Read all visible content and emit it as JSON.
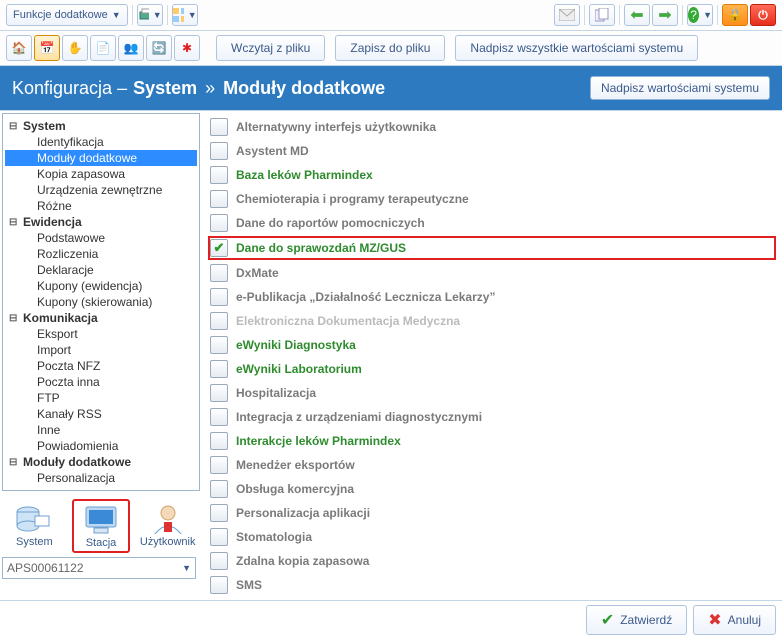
{
  "top_toolbar": {
    "functions_label": "Funkcje dodatkowe"
  },
  "second_toolbar": {
    "buttons": {
      "load": "Wczytaj z pliku",
      "save": "Zapisz do pliku",
      "overwrite_all": "Nadpisz wszystkie wartościami systemu"
    }
  },
  "breadcrumb": {
    "prefix": "Konfiguracja –",
    "section": "System",
    "sep": "»",
    "sub": "Moduły dodatkowe",
    "right_btn": "Nadpisz wartościami systemu"
  },
  "tree": {
    "categories": [
      {
        "label": "System",
        "children": [
          "Identyfikacja",
          "Moduły dodatkowe",
          "Kopia zapasowa",
          "Urządzenia zewnętrzne",
          "Różne"
        ],
        "selected": 1
      },
      {
        "label": "Ewidencja",
        "children": [
          "Podstawowe",
          "Rozliczenia",
          "Deklaracje",
          "Kupony (ewidencja)",
          "Kupony (skierowania)"
        ]
      },
      {
        "label": "Komunikacja",
        "children": [
          "Eksport",
          "Import",
          "Poczta NFZ",
          "Poczta inna",
          "FTP",
          "Kanały RSS",
          "Inne",
          "Powiadomienia"
        ]
      },
      {
        "label": "Moduły dodatkowe",
        "children": [
          "Personalizacja"
        ]
      }
    ]
  },
  "side_tabs": {
    "system": "System",
    "station": "Stacja",
    "user": "Użytkownik"
  },
  "status": {
    "code": "APS00061122"
  },
  "options": [
    {
      "label": "Alternatywny interfejs użytkownika",
      "checked": false,
      "style": "normal"
    },
    {
      "label": "Asystent MD",
      "checked": false,
      "style": "normal"
    },
    {
      "label": "Baza leków Pharmindex",
      "checked": false,
      "style": "green"
    },
    {
      "label": "Chemioterapia i programy terapeutyczne",
      "checked": false,
      "style": "normal"
    },
    {
      "label": "Dane do raportów pomocniczych",
      "checked": false,
      "style": "normal"
    },
    {
      "label": "Dane do sprawozdań MZ/GUS",
      "checked": true,
      "style": "green",
      "highlight": true
    },
    {
      "label": "DxMate",
      "checked": false,
      "style": "normal"
    },
    {
      "label": "e-Publikacja „Działalność Lecznicza Lekarzy”",
      "checked": false,
      "style": "normal"
    },
    {
      "label": "Elektroniczna Dokumentacja Medyczna",
      "checked": false,
      "style": "disabled"
    },
    {
      "label": "eWyniki Diagnostyka",
      "checked": false,
      "style": "green"
    },
    {
      "label": "eWyniki Laboratorium",
      "checked": false,
      "style": "green"
    },
    {
      "label": "Hospitalizacja",
      "checked": false,
      "style": "normal"
    },
    {
      "label": "Integracja z urządzeniami diagnostycznymi",
      "checked": false,
      "style": "normal"
    },
    {
      "label": "Interakcje leków Pharmindex",
      "checked": false,
      "style": "green"
    },
    {
      "label": "Menedżer eksportów",
      "checked": false,
      "style": "normal"
    },
    {
      "label": "Obsługa komercyjna",
      "checked": false,
      "style": "normal"
    },
    {
      "label": "Personalizacja aplikacji",
      "checked": false,
      "style": "normal"
    },
    {
      "label": "Stomatologia",
      "checked": false,
      "style": "normal"
    },
    {
      "label": "Zdalna kopia zapasowa",
      "checked": false,
      "style": "normal"
    },
    {
      "label": "SMS",
      "checked": false,
      "style": "normal"
    }
  ],
  "footer": {
    "confirm": "Zatwierdź",
    "cancel": "Anuluj"
  }
}
